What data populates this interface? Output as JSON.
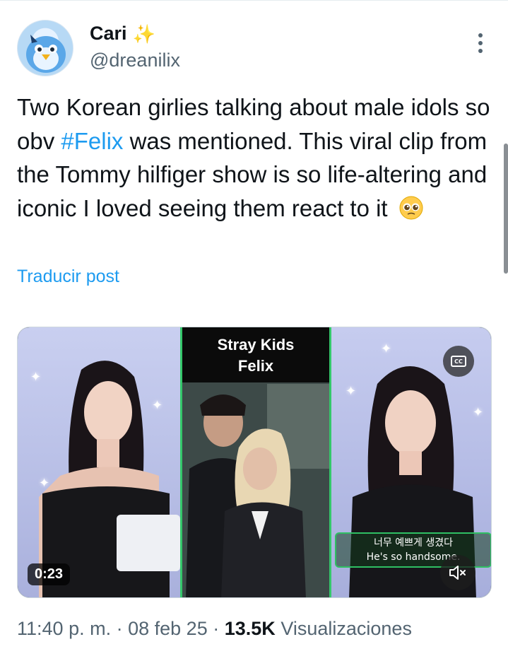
{
  "post": {
    "author": {
      "display_name": "Cari",
      "name_emoji": "✨",
      "handle": "@dreanilix"
    },
    "text": {
      "part1": "Two Korean girlies talking about male idols so obv ",
      "hashtag": "#Felix",
      "part2": " was mentioned. This viral clip from the Tommy hilfiger show is so life-altering and iconic I loved seeing them react to it"
    },
    "translate_label": "Traducir post",
    "video": {
      "center_title_line1": "Stray Kids",
      "center_title_line2": "Felix",
      "subtitle_korean": "너무 예쁘게 생겼다",
      "subtitle_english": "He's so handsome.",
      "duration": "0:23",
      "cc_label": "CC"
    },
    "meta": {
      "time": "11:40 p. m.",
      "separator": "·",
      "date": "08 feb 25",
      "views_count": "13.5K",
      "views_label": "Visualizaciones"
    }
  },
  "icons": {
    "more": "more-vertical-icon",
    "cc": "closed-captions-icon",
    "mute": "speaker-muted-icon",
    "emoji": "pleading-face-emoji"
  },
  "colors": {
    "link": "#1d9bf0",
    "secondary_text": "#536471",
    "primary_text": "#0f1419",
    "subtitle_border": "#2fbf63"
  }
}
